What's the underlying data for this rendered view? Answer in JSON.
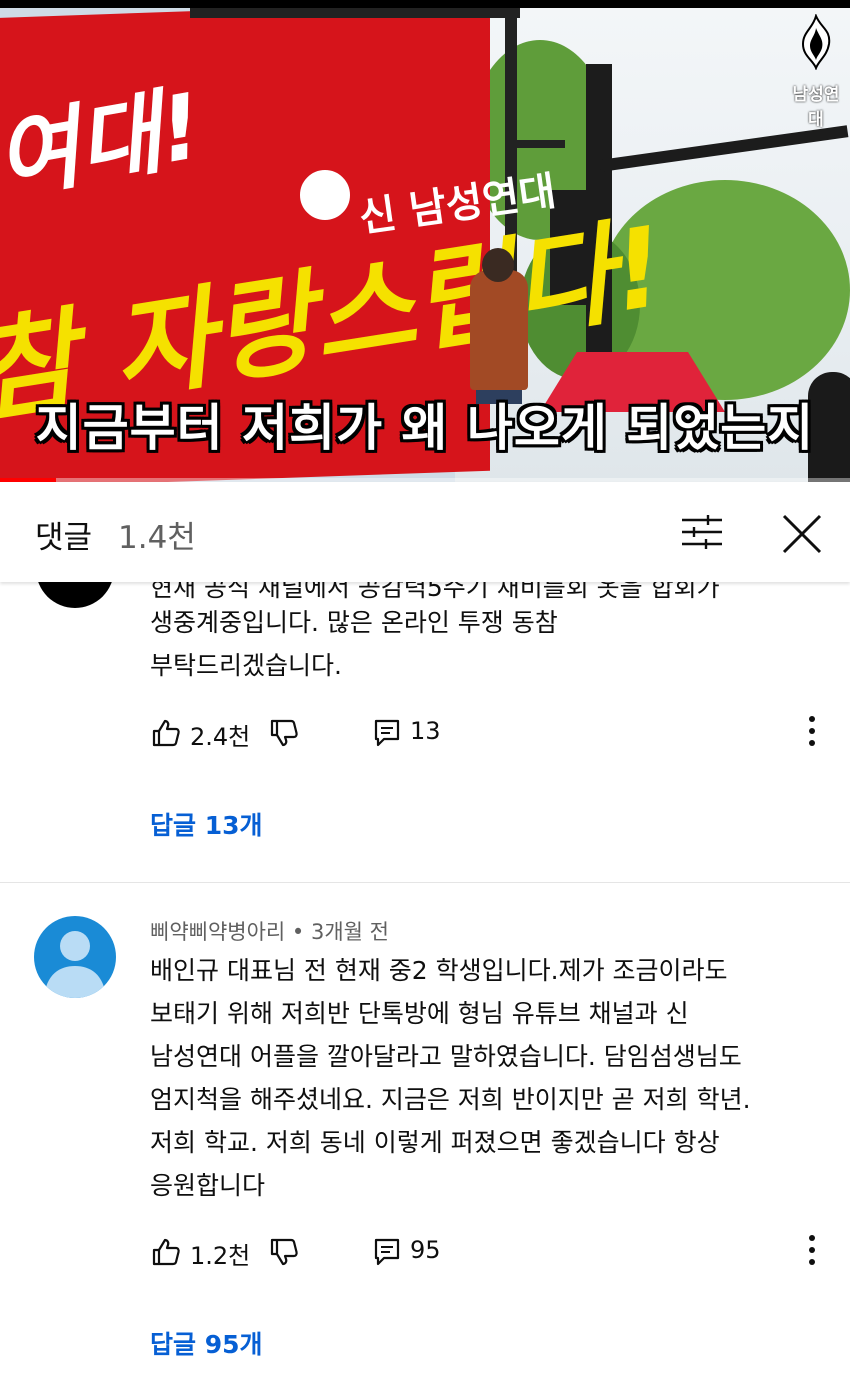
{
  "video": {
    "banner_slogan_partial": "여대!",
    "banner_slogan_main": "참 자랑스럽다!",
    "banner_org": "신 남성연대",
    "caption": "지금부터 저희가 왜 나오게 되었는지",
    "channel_watermark": "남성연대",
    "progress_fraction": 0.066
  },
  "sheet": {
    "title": "댓글",
    "count": "1.4천",
    "filter_icon": "sliders-icon",
    "close_icon": "close-icon"
  },
  "comments": [
    {
      "author": "",
      "partial_text": "현재 공식 채널에서 공감력5주기 채비를회 옷을 합회가",
      "lines": [
        "생중계중입니다. 많은 온라인 투쟁 동참",
        "부탁드리겠습니다."
      ],
      "likes": "2.4천",
      "reply_count": "13",
      "replies_link": "답글 13개"
    },
    {
      "author": "삐약삐약병아리 • 3개월 전",
      "lines": [
        "배인규 대표님 전 현재 중2 학생입니다.제가 조금이라도",
        "보태기 위해 저희반 단톡방에 형님 유튜브 채널과 신",
        "남성연대 어플을 깔아달라고 말하였습니다. 담임섬생님도",
        "엄지척을 해주셨네요. 지금은 저희 반이지만 곧 저희 학년.",
        "저희 학교. 저희 동네 이렇게 퍼졌으면 좋겠습니다 항상",
        "응원합니다"
      ],
      "likes": "1.2천",
      "reply_count": "95",
      "replies_link": "답글 95개"
    }
  ],
  "colors": {
    "link_blue": "#065fd4",
    "banner_red": "#d6141b",
    "avatar_blue": "#1a8bd6"
  }
}
